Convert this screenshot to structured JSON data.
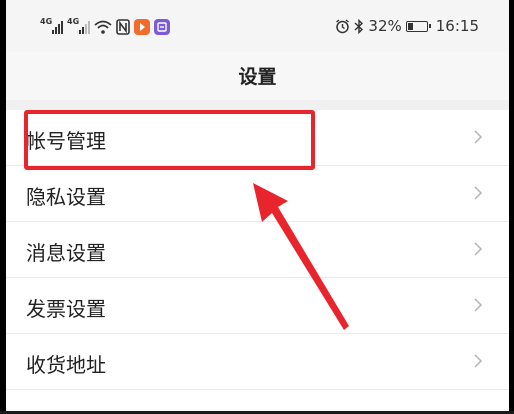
{
  "status_bar": {
    "signal1_label": "4G",
    "signal2_label": "4G",
    "alarm_icon": "alarm-clock-icon",
    "bluetooth_icon": "bluetooth-icon",
    "battery_percent": "32%",
    "battery_level": 0.32,
    "time": "16:15"
  },
  "header": {
    "title": "设置"
  },
  "settings": {
    "items": [
      {
        "label": "帐号管理"
      },
      {
        "label": "隐私设置"
      },
      {
        "label": "消息设置"
      },
      {
        "label": "发票设置"
      },
      {
        "label": "收货地址"
      }
    ]
  },
  "colors": {
    "highlight": "#e8242c",
    "app_badge_orange": "#f26b2a",
    "app_badge_purple": "#7b5bd6"
  }
}
